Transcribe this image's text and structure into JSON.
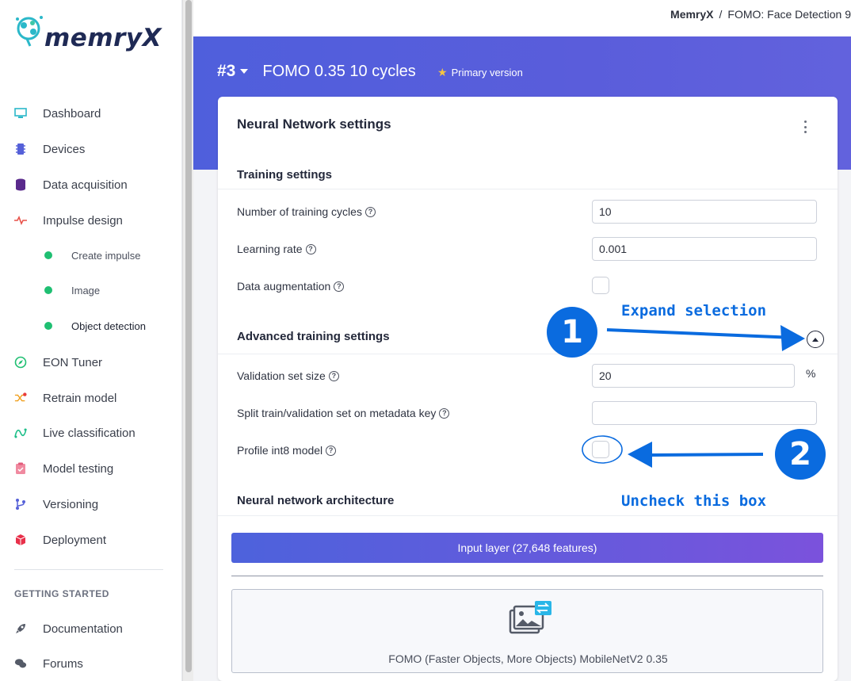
{
  "brand": {
    "logo_text_main": "memry",
    "logo_text_end": "X"
  },
  "breadcrumb": {
    "project": "MemryX",
    "separator": "/",
    "page": "FOMO: Face Detection 9"
  },
  "sidebar": {
    "items": [
      {
        "label": "Dashboard",
        "icon": "monitor-icon"
      },
      {
        "label": "Devices",
        "icon": "chip-icon"
      },
      {
        "label": "Data acquisition",
        "icon": "database-icon"
      },
      {
        "label": "Impulse design",
        "icon": "pulse-icon"
      },
      {
        "label": "EON Tuner",
        "icon": "compass-icon"
      },
      {
        "label": "Retrain model",
        "icon": "shuffle-icon"
      },
      {
        "label": "Live classification",
        "icon": "signal-icon"
      },
      {
        "label": "Model testing",
        "icon": "clipboard-icon"
      },
      {
        "label": "Versioning",
        "icon": "branch-icon"
      },
      {
        "label": "Deployment",
        "icon": "cube-icon"
      }
    ],
    "subitems": [
      {
        "label": "Create impulse"
      },
      {
        "label": "Image"
      },
      {
        "label": "Object detection"
      }
    ],
    "section_label": "GETTING STARTED",
    "footer_items": [
      {
        "label": "Documentation",
        "icon": "rocket-icon"
      },
      {
        "label": "Forums",
        "icon": "chat-icon"
      }
    ]
  },
  "header": {
    "version_number": "#3",
    "version_name": "FOMO 0.35 10 cycles",
    "primary_label": "Primary version"
  },
  "card": {
    "title": "Neural Network settings",
    "training_settings": {
      "title": "Training settings",
      "cycles_label": "Number of training cycles",
      "cycles_value": "10",
      "lr_label": "Learning rate",
      "lr_value": "0.001",
      "augmentation_label": "Data augmentation"
    },
    "advanced": {
      "title": "Advanced training settings",
      "validation_label": "Validation set size",
      "validation_value": "20",
      "validation_unit": "%",
      "split_label": "Split train/validation set on metadata key",
      "split_value": "",
      "profile_label": "Profile int8 model"
    },
    "architecture": {
      "title": "Neural network architecture",
      "input_layer": "Input layer (27,648 features)",
      "block_label": "FOMO (Faster Objects, More Objects) MobileNetV2 0.35"
    }
  },
  "annotations": {
    "step1_number": "1",
    "step1_text": "Expand selection",
    "step2_number": "2",
    "step2_text": "Uncheck this box",
    "color": "#0a6bdf"
  },
  "colors": {
    "banner": "#5a5ddb",
    "accent_green": "#1fbf72",
    "annotation_blue": "#0a6bdf"
  }
}
